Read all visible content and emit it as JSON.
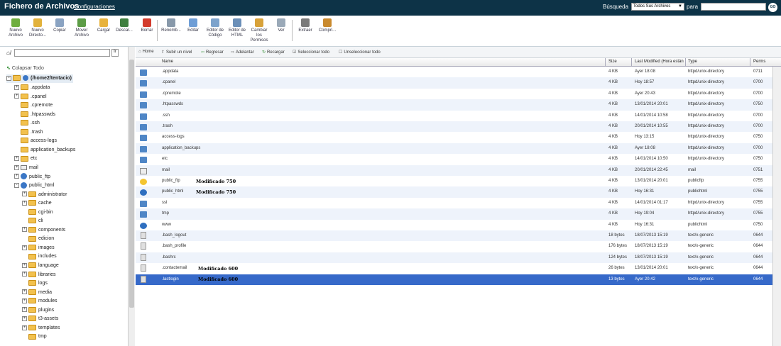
{
  "header": {
    "title": "Fichero de Archivos",
    "config_link": "Configuraciones",
    "search_label": "Búsqueda",
    "search_scope": "Todos Sus Archivos",
    "search_for": "para",
    "go_label": "GO"
  },
  "toolbar": {
    "buttons": [
      {
        "label": "Nuevo Archivo",
        "icon": "new-file-icon",
        "color": "#6fae3f"
      },
      {
        "label": "Nuevo Directo...",
        "icon": "new-folder-icon",
        "color": "#e2b23c"
      },
      {
        "label": "Copiar",
        "icon": "copy-icon",
        "color": "#8aa3c2"
      },
      {
        "label": "Mover Archivo",
        "icon": "move-icon",
        "color": "#5c9c46"
      },
      {
        "label": "Cargar",
        "icon": "upload-icon",
        "color": "#e8b33d"
      },
      {
        "label": "Descar...",
        "icon": "download-icon",
        "color": "#3f7f3f"
      },
      {
        "label": "Borrar",
        "icon": "delete-icon",
        "color": "#d33b2c"
      },
      {
        "label": "Renomb...",
        "icon": "rename-icon",
        "color": "#8899aa"
      },
      {
        "label": "Editar",
        "icon": "edit-icon",
        "color": "#6f9ed6"
      },
      {
        "label": "Editor de Código",
        "icon": "code-editor-icon",
        "color": "#7da3cc"
      },
      {
        "label": "Editor de HTML",
        "icon": "html-editor-icon",
        "color": "#6b8fb8"
      },
      {
        "label": "Cambiar los Permisos",
        "icon": "permissions-icon",
        "color": "#d8a23a"
      },
      {
        "label": "Ver",
        "icon": "view-icon",
        "color": "#9aa9b8"
      },
      {
        "label": "Extraer",
        "icon": "extract-icon",
        "color": "#7a7a7a"
      },
      {
        "label": "Compri...",
        "icon": "compress-icon",
        "color": "#c98a2e"
      }
    ]
  },
  "tree": {
    "collapse_all": "Colapsar Todo",
    "root": "(/home2/tentacio)",
    "items": [
      {
        "label": ".appdata",
        "level": 1,
        "expander": "+",
        "icon": "folder"
      },
      {
        "label": ".cpanel",
        "level": 1,
        "expander": "+",
        "icon": "folder"
      },
      {
        "label": ".cpremote",
        "level": 1,
        "expander": "",
        "icon": "folder"
      },
      {
        "label": ".htpasswds",
        "level": 1,
        "expander": "",
        "icon": "folder"
      },
      {
        "label": ".ssh",
        "level": 1,
        "expander": "",
        "icon": "folder"
      },
      {
        "label": ".trash",
        "level": 1,
        "expander": "",
        "icon": "folder"
      },
      {
        "label": "access-logs",
        "level": 1,
        "expander": "",
        "icon": "folder"
      },
      {
        "label": "application_backups",
        "level": 1,
        "expander": "",
        "icon": "folder"
      },
      {
        "label": "etc",
        "level": 1,
        "expander": "+",
        "icon": "folder"
      },
      {
        "label": "mail",
        "level": 1,
        "expander": "+",
        "icon": "mail"
      },
      {
        "label": "public_ftp",
        "level": 1,
        "expander": "+",
        "icon": "globe"
      },
      {
        "label": "public_html",
        "level": 1,
        "expander": "-",
        "icon": "globe"
      },
      {
        "label": "administrator",
        "level": 2,
        "expander": "+",
        "icon": "folder"
      },
      {
        "label": "cache",
        "level": 2,
        "expander": "+",
        "icon": "folder"
      },
      {
        "label": "cgi-bin",
        "level": 2,
        "expander": "",
        "icon": "folder"
      },
      {
        "label": "cli",
        "level": 2,
        "expander": "",
        "icon": "folder"
      },
      {
        "label": "components",
        "level": 2,
        "expander": "+",
        "icon": "folder"
      },
      {
        "label": "edicion",
        "level": 2,
        "expander": "",
        "icon": "folder"
      },
      {
        "label": "images",
        "level": 2,
        "expander": "+",
        "icon": "folder"
      },
      {
        "label": "includes",
        "level": 2,
        "expander": "",
        "icon": "folder"
      },
      {
        "label": "language",
        "level": 2,
        "expander": "+",
        "icon": "folder"
      },
      {
        "label": "libraries",
        "level": 2,
        "expander": "+",
        "icon": "folder"
      },
      {
        "label": "logs",
        "level": 2,
        "expander": "",
        "icon": "folder"
      },
      {
        "label": "media",
        "level": 2,
        "expander": "+",
        "icon": "folder"
      },
      {
        "label": "modules",
        "level": 2,
        "expander": "+",
        "icon": "folder"
      },
      {
        "label": "plugins",
        "level": 2,
        "expander": "+",
        "icon": "folder"
      },
      {
        "label": "t3-assets",
        "level": 2,
        "expander": "+",
        "icon": "folder"
      },
      {
        "label": "templates",
        "level": 2,
        "expander": "+",
        "icon": "folder"
      },
      {
        "label": "tmp",
        "level": 2,
        "expander": "",
        "icon": "folder"
      }
    ]
  },
  "navbar": {
    "home": "Home",
    "up": "Subir un nivel",
    "back": "Regresar",
    "forward": "Adelantar",
    "reload": "Recargar",
    "select_all": "Seleccionar todo",
    "unselect_all": "Unseleccionar todo"
  },
  "table": {
    "columns": [
      "Name",
      "Size",
      "Last Modified (Hora están",
      "Type",
      "Perms"
    ],
    "rows": [
      {
        "name": ".appdata",
        "size": "4 KB",
        "modified": "Ayer 18:08",
        "type": "httpd/unix-directory",
        "perms": "0711",
        "icon": "dir",
        "note": ""
      },
      {
        "name": ".cpanel",
        "size": "4 KB",
        "modified": "Hoy 18:57",
        "type": "httpd/unix-directory",
        "perms": "0700",
        "icon": "dir",
        "note": ""
      },
      {
        "name": ".cpremote",
        "size": "4 KB",
        "modified": "Ayer 20:43",
        "type": "httpd/unix-directory",
        "perms": "0700",
        "icon": "dir",
        "note": ""
      },
      {
        "name": ".htpasswds",
        "size": "4 KB",
        "modified": "13/01/2014 20:01",
        "type": "httpd/unix-directory",
        "perms": "0750",
        "icon": "dir",
        "note": ""
      },
      {
        "name": ".ssh",
        "size": "4 KB",
        "modified": "14/01/2014 10:58",
        "type": "httpd/unix-directory",
        "perms": "0700",
        "icon": "dir",
        "note": ""
      },
      {
        "name": ".trash",
        "size": "4 KB",
        "modified": "20/01/2014 10:55",
        "type": "httpd/unix-directory",
        "perms": "0700",
        "icon": "dir",
        "note": ""
      },
      {
        "name": "access-logs",
        "size": "4 KB",
        "modified": "Hoy 13:15",
        "type": "httpd/unix-directory",
        "perms": "0750",
        "icon": "dir",
        "note": ""
      },
      {
        "name": "application_backups",
        "size": "4 KB",
        "modified": "Ayer 18:08",
        "type": "httpd/unix-directory",
        "perms": "0700",
        "icon": "dir",
        "note": ""
      },
      {
        "name": "etc",
        "size": "4 KB",
        "modified": "14/01/2014 10:50",
        "type": "httpd/unix-directory",
        "perms": "0750",
        "icon": "dir",
        "note": ""
      },
      {
        "name": "mail",
        "size": "4 KB",
        "modified": "20/01/2014 22:45",
        "type": "mail",
        "perms": "0751",
        "icon": "mail",
        "note": ""
      },
      {
        "name": "public_ftp",
        "size": "4 KB",
        "modified": "13/01/2014 20:01",
        "type": "publicftp",
        "perms": "0755",
        "icon": "ftp",
        "note": "Modificado 750"
      },
      {
        "name": "public_html",
        "size": "4 KB",
        "modified": "Hoy 16:31",
        "type": "publichtml",
        "perms": "0755",
        "icon": "globe",
        "note": "Modificado 750"
      },
      {
        "name": "ssl",
        "size": "4 KB",
        "modified": "14/01/2014 01:17",
        "type": "httpd/unix-directory",
        "perms": "0755",
        "icon": "dir",
        "note": ""
      },
      {
        "name": "tmp",
        "size": "4 KB",
        "modified": "Hoy 19:04",
        "type": "httpd/unix-directory",
        "perms": "0755",
        "icon": "dir",
        "note": ""
      },
      {
        "name": "www",
        "size": "4 KB",
        "modified": "Hoy 16:31",
        "type": "publichtml",
        "perms": "0750",
        "icon": "globe",
        "note": ""
      },
      {
        "name": ".bash_logout",
        "size": "18 bytes",
        "modified": "18/07/2013 15:19",
        "type": "text/x-generic",
        "perms": "0644",
        "icon": "file",
        "note": ""
      },
      {
        "name": ".bash_profile",
        "size": "176 bytes",
        "modified": "18/07/2013 15:19",
        "type": "text/x-generic",
        "perms": "0644",
        "icon": "file",
        "note": ""
      },
      {
        "name": ".bashrc",
        "size": "124 bytes",
        "modified": "18/07/2013 15:19",
        "type": "text/x-generic",
        "perms": "0644",
        "icon": "file",
        "note": ""
      },
      {
        "name": ".contactemail",
        "size": "26 bytes",
        "modified": "13/01/2014 20:01",
        "type": "text/x-generic",
        "perms": "0644",
        "icon": "file",
        "note": "Modificado 600"
      },
      {
        "name": ".lastlogin",
        "size": "13 bytes",
        "modified": "Ayer 20:42",
        "type": "text/x-generic",
        "perms": "0644",
        "icon": "file",
        "note": "Modificado 600",
        "selected": true
      }
    ]
  }
}
